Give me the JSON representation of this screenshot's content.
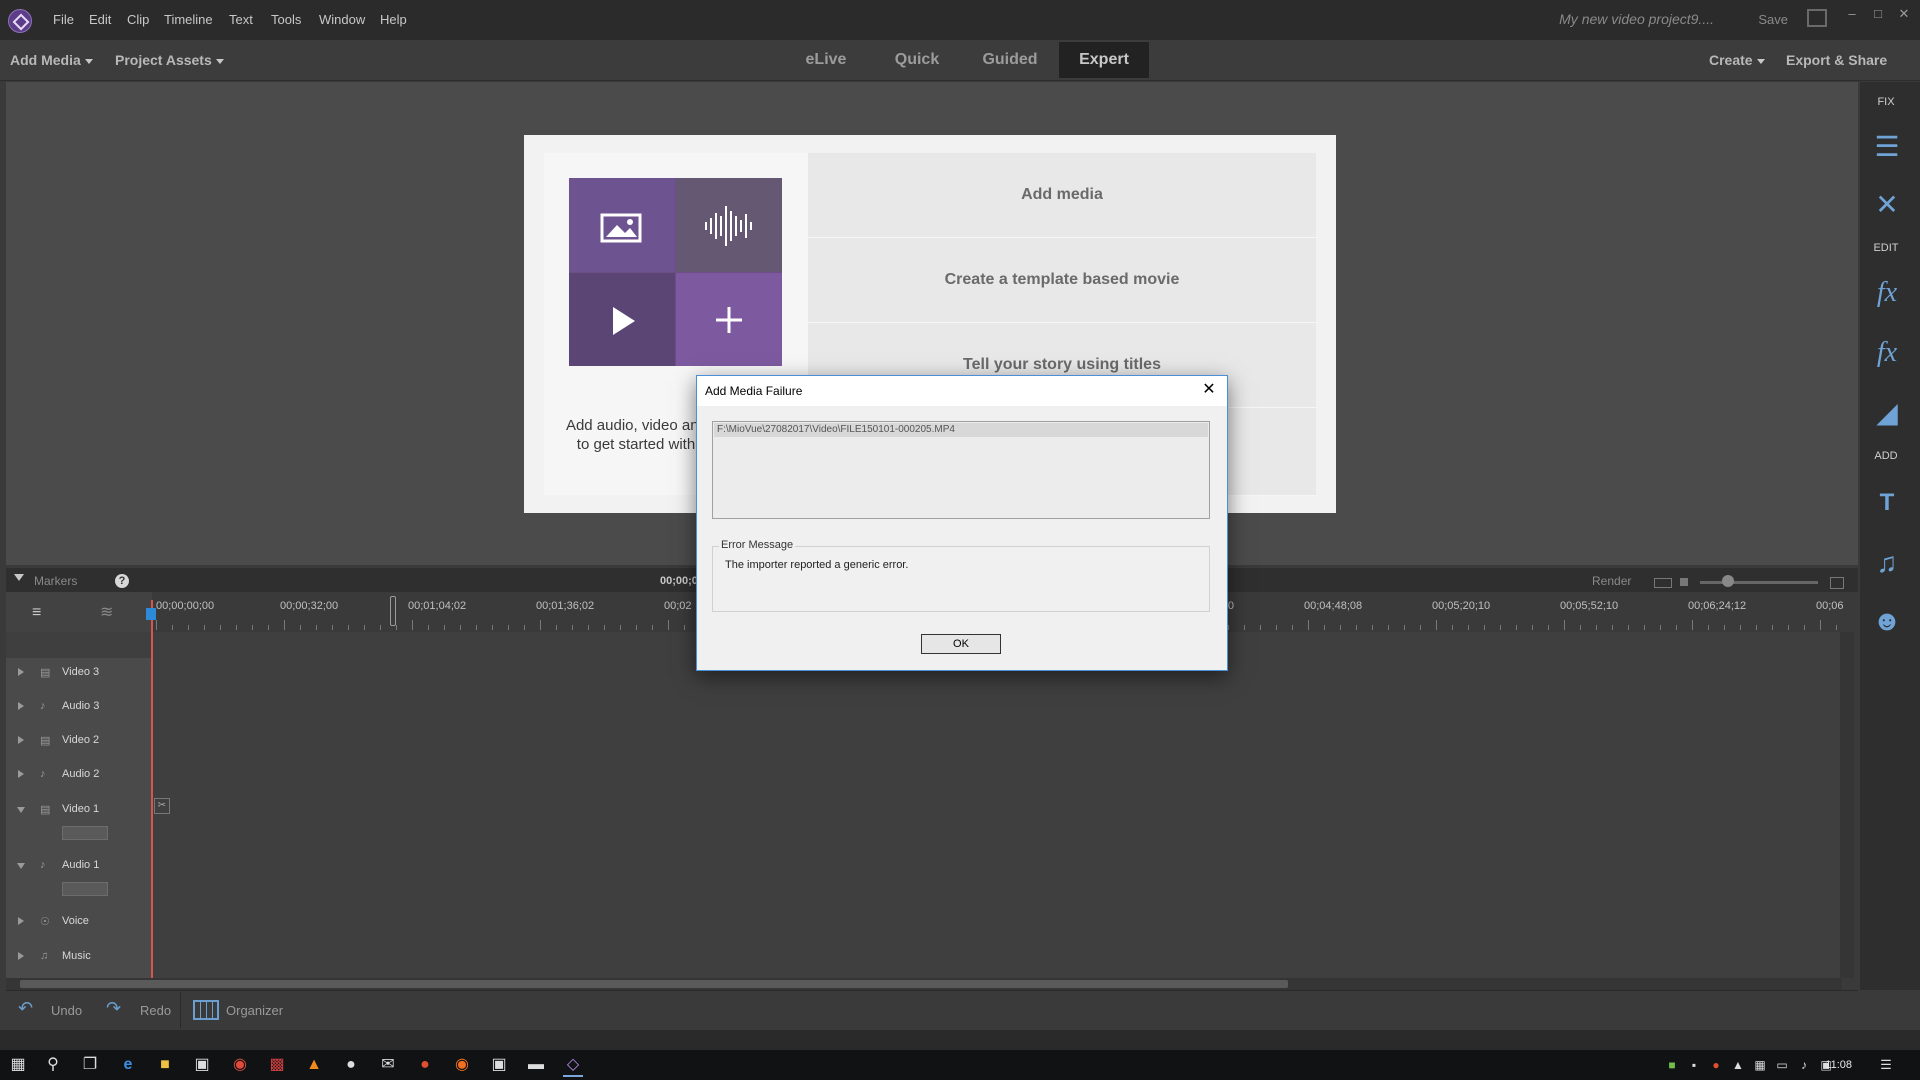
{
  "app": {
    "menu": [
      "File",
      "Edit",
      "Clip",
      "Timeline",
      "Text",
      "Tools",
      "Window",
      "Help"
    ],
    "project_title": "My new video project9....",
    "save_label": "Save"
  },
  "toolbar": {
    "add_media": "Add Media",
    "project_assets": "Project Assets",
    "modes": [
      "eLive",
      "Quick",
      "Guided",
      "Expert"
    ],
    "active_mode": "Expert",
    "create": "Create",
    "export_share": "Export & Share"
  },
  "welcome": {
    "options": [
      "Add media",
      "Create a template based movie",
      "Tell your story using titles"
    ],
    "text_line1": "Add audio, video anc",
    "text_line2": "to get started with"
  },
  "right_panel": {
    "fix_label": "FIX",
    "edit_label": "EDIT",
    "add_label": "ADD",
    "icons": [
      "adjust-icon",
      "tools-icon",
      "effects-edit-icon",
      "fx-icon",
      "transitions-icon",
      "titles-icon",
      "music-icon",
      "graphics-icon"
    ]
  },
  "timeline": {
    "markers_label": "Markers",
    "render_label": "Render",
    "center_timecode": "00;00;0",
    "timecodes": [
      "00;00;00;00",
      "00;00;32;00",
      "00;01;04;02",
      "00;01;36;02",
      "00;02",
      "00;04;16;08",
      "00;04;48;08",
      "00;05;20;10",
      "00;05;52;10",
      "00;06;24;12",
      "00;06"
    ],
    "tracks": [
      "Video 3",
      "Audio 3",
      "Video 2",
      "Audio 2",
      "Video 1",
      "Audio 1",
      "Voice",
      "Music"
    ]
  },
  "bottom": {
    "undo": "Undo",
    "redo": "Redo",
    "organizer": "Organizer"
  },
  "taskbar": {
    "clock": "11:08"
  },
  "dialog": {
    "title": "Add Media Failure",
    "file_path": "F:\\MioVue\\27082017\\Video\\FILE150101-000205.MP4",
    "group_label": "Error Message",
    "message": "The importer reported a generic error.",
    "ok_label": "OK"
  }
}
